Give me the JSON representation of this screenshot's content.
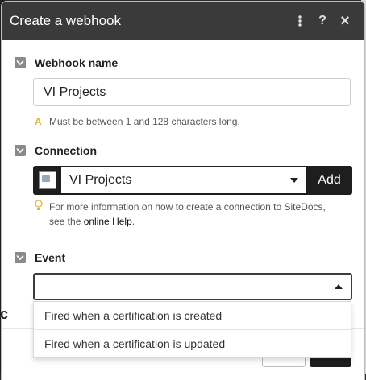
{
  "dialog": {
    "title": "Create a webhook",
    "header_icons": [
      "more-vertical-icon",
      "help-icon",
      "close-icon"
    ],
    "help_glyph": "?",
    "close_glyph": "×"
  },
  "webhook_name": {
    "label": "Webhook name",
    "value": "VI Projects",
    "hint_glyph": "A",
    "hint": "Must be between 1 and 128 characters long."
  },
  "connection": {
    "label": "Connection",
    "selected": "VI Projects",
    "add_label": "Add",
    "hint_before": "For more information on how to create a connection to SiteDocs, see the ",
    "hint_link": "online Help",
    "hint_after": "."
  },
  "event": {
    "label": "Event",
    "value": "",
    "options": [
      "Fired when a certification is created",
      "Fired when a certification is updated"
    ]
  },
  "background": {
    "side_text": "c"
  }
}
